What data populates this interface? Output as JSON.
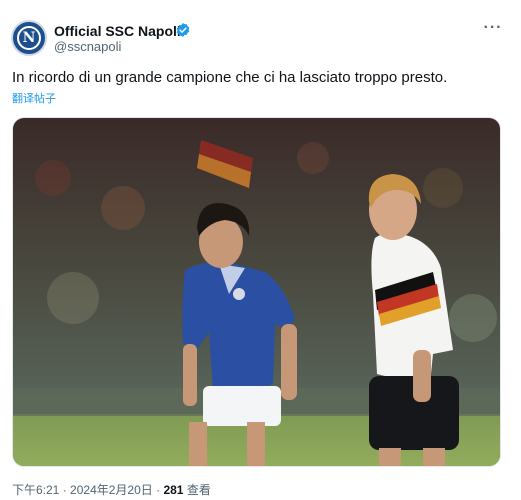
{
  "author": {
    "name": "Official SSC Napoli",
    "handle": "@sscnapoli",
    "avatar_letter": "N",
    "verified": true
  },
  "tweet": {
    "text": "In ricordo di un grande campione che ci ha lasciato troppo presto.",
    "translate_label": "翻译帖子",
    "more_icon": "more-icon",
    "media_icon": "photo"
  },
  "footer": {
    "time": "下午6:21",
    "separator1": "·",
    "date": "2024年2月20日",
    "separator2": "·",
    "views_count": "281",
    "views_label": "查看"
  },
  "colors": {
    "accent": "#1d9bf0",
    "verified": "#1d9bf0",
    "secondary_text": "#536471",
    "napoli_blue": "#1d4f8f"
  }
}
